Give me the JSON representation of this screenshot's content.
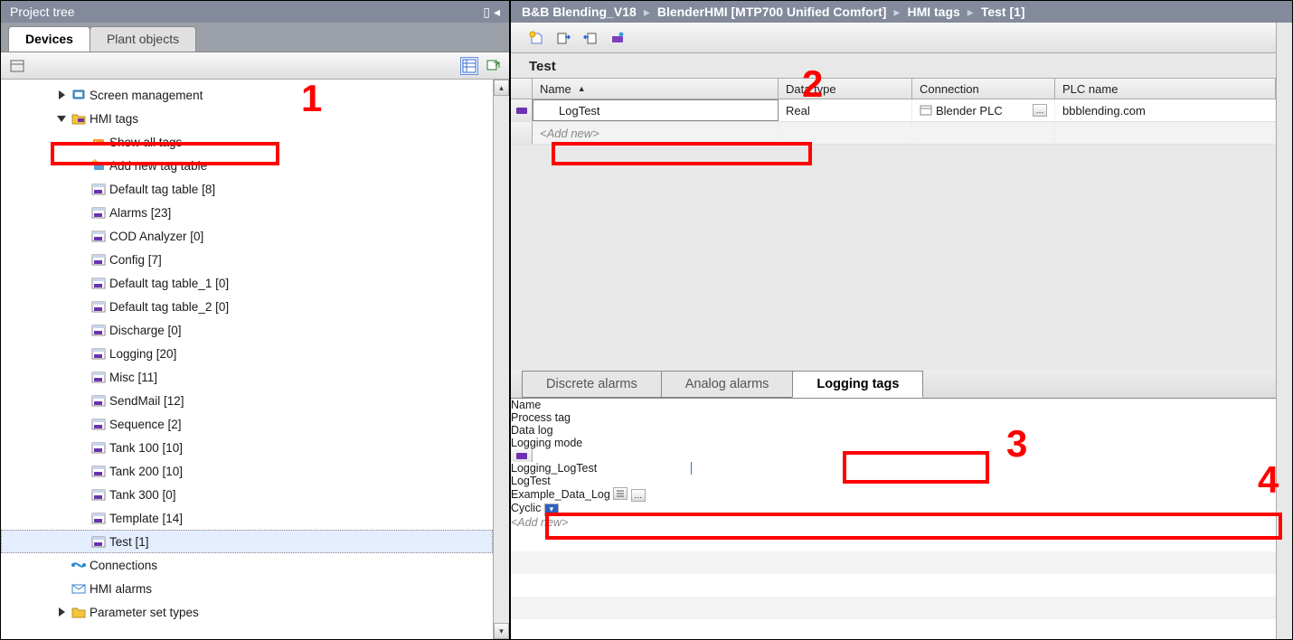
{
  "left": {
    "title": "Project tree",
    "tabs": [
      "Devices",
      "Plant objects"
    ],
    "active_tab": 0,
    "tree": [
      {
        "depth": 1,
        "icon": "folder-screen",
        "label": "Screen management",
        "expander": "closed"
      },
      {
        "depth": 1,
        "icon": "folder-tags",
        "label": "HMI tags",
        "expander": "open",
        "redbox": true
      },
      {
        "depth": 2,
        "icon": "tag-orange",
        "label": "Show all tags"
      },
      {
        "depth": 2,
        "icon": "add-star",
        "label": "Add new tag table"
      },
      {
        "depth": 2,
        "icon": "tagtable",
        "label": "Default tag table [8]"
      },
      {
        "depth": 2,
        "icon": "tagtable",
        "label": "Alarms [23]"
      },
      {
        "depth": 2,
        "icon": "tagtable",
        "label": "COD Analyzer [0]"
      },
      {
        "depth": 2,
        "icon": "tagtable",
        "label": "Config [7]"
      },
      {
        "depth": 2,
        "icon": "tagtable",
        "label": "Default tag table_1 [0]"
      },
      {
        "depth": 2,
        "icon": "tagtable",
        "label": "Default tag table_2 [0]"
      },
      {
        "depth": 2,
        "icon": "tagtable",
        "label": "Discharge [0]"
      },
      {
        "depth": 2,
        "icon": "tagtable",
        "label": "Logging [20]"
      },
      {
        "depth": 2,
        "icon": "tagtable",
        "label": "Misc [11]"
      },
      {
        "depth": 2,
        "icon": "tagtable",
        "label": "SendMail [12]"
      },
      {
        "depth": 2,
        "icon": "tagtable",
        "label": "Sequence [2]"
      },
      {
        "depth": 2,
        "icon": "tagtable",
        "label": "Tank 100 [10]"
      },
      {
        "depth": 2,
        "icon": "tagtable",
        "label": "Tank 200 [10]"
      },
      {
        "depth": 2,
        "icon": "tagtable",
        "label": "Tank 300 [0]"
      },
      {
        "depth": 2,
        "icon": "tagtable",
        "label": "Template [14]"
      },
      {
        "depth": 2,
        "icon": "tagtable",
        "label": "Test [1]",
        "selected": true
      },
      {
        "depth": 1,
        "icon": "conn",
        "label": "Connections"
      },
      {
        "depth": 1,
        "icon": "mail",
        "label": "HMI alarms"
      },
      {
        "depth": 1,
        "icon": "folder",
        "label": "Parameter set types",
        "expander": "closed"
      }
    ]
  },
  "breadcrumb": [
    "B&B Blending_V18",
    "BlenderHMI [MTP700 Unified Comfort]",
    "HMI tags",
    "Test [1]"
  ],
  "main": {
    "section_title": "Test",
    "top_cols": [
      "Name",
      "Data type",
      "Connection",
      "PLC name"
    ],
    "top_row": {
      "name": "LogTest",
      "type": "Real",
      "conn": "Blender PLC",
      "plc": "bbblending.com"
    },
    "add_new": "<Add new>",
    "sub_tabs": [
      "Discrete alarms",
      "Analog alarms",
      "Logging tags"
    ],
    "sub_active": 2,
    "bottom_cols": [
      "Name",
      "Process tag",
      "Data log",
      "Logging mode"
    ],
    "bottom_row": {
      "name": "Logging_LogTest",
      "tag": "LogTest",
      "log": "Example_Data_Log",
      "mode": "Cyclic"
    }
  },
  "annotations": {
    "1": "1",
    "2": "2",
    "3": "3",
    "4": "4"
  }
}
